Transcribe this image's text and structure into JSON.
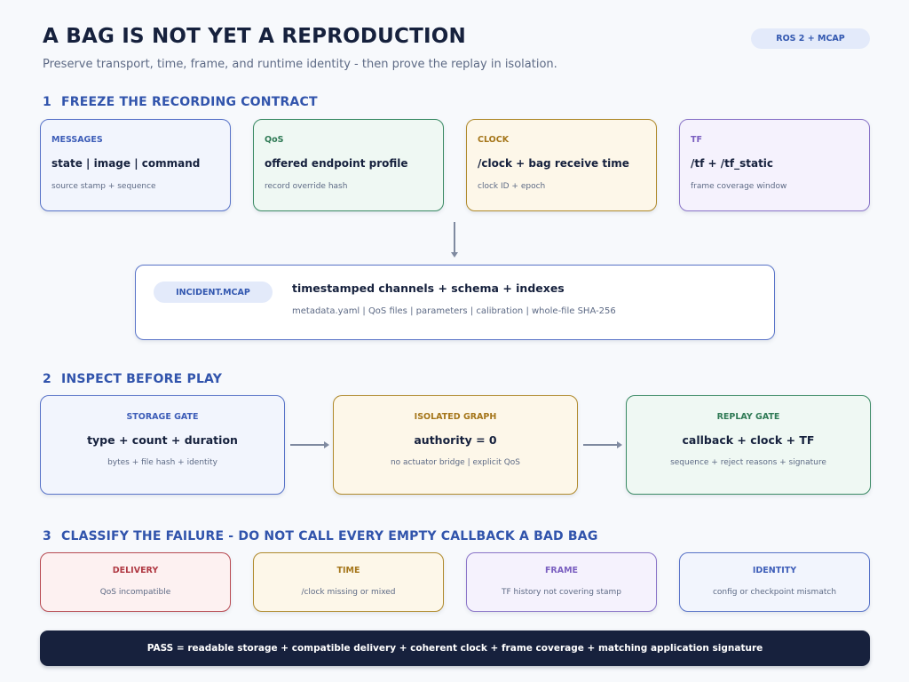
{
  "header": {
    "title": "A BAG IS NOT YET A REPRODUCTION",
    "subtitle": "Preserve transport, time, frame, and runtime identity - then prove the replay in isolation.",
    "tag": "ROS 2 + MCAP"
  },
  "section1": {
    "number": "1",
    "title": "FREEZE THE RECORDING CONTRACT",
    "cards": [
      {
        "label": "MESSAGES",
        "main": "state | image | command",
        "sub": "source stamp + sequence",
        "color": "#3d5db8"
      },
      {
        "label": "QoS",
        "main": "offered endpoint profile",
        "sub": "record override hash",
        "color": "#2f7a55"
      },
      {
        "label": "CLOCK",
        "main": "/clock + bag receive time",
        "sub": "clock ID + epoch",
        "color": "#a5761a"
      },
      {
        "label": "TF",
        "main": "/tf + /tf_static",
        "sub": "frame coverage window",
        "color": "#7a5fc0"
      }
    ],
    "artifact": {
      "pill": "INCIDENT.MCAP",
      "main": "timestamped channels + schema + indexes",
      "sub": "metadata.yaml | QoS files | parameters | calibration | whole-file SHA-256"
    }
  },
  "section2": {
    "number": "2",
    "title": "INSPECT BEFORE PLAY",
    "cards": [
      {
        "label": "STORAGE GATE",
        "main": "type + count + duration",
        "sub": "bytes + file hash + identity"
      },
      {
        "label": "ISOLATED GRAPH",
        "main": "authority = 0",
        "sub": "no actuator bridge | explicit QoS"
      },
      {
        "label": "REPLAY GATE",
        "main": "callback + clock + TF",
        "sub": "sequence + reject reasons + signature"
      }
    ]
  },
  "section3": {
    "number": "3",
    "title": "CLASSIFY THE FAILURE - DO NOT CALL EVERY EMPTY CALLBACK A BAD BAG",
    "cards": [
      {
        "label": "DELIVERY",
        "sub": "QoS incompatible"
      },
      {
        "label": "TIME",
        "sub": "/clock missing or mixed"
      },
      {
        "label": "FRAME",
        "sub": "TF history not covering stamp"
      },
      {
        "label": "IDENTITY",
        "sub": "config or checkpoint mismatch"
      }
    ]
  },
  "footer": {
    "pass": "PASS = readable storage + compatible delivery + coherent clock + frame coverage + matching application signature"
  }
}
